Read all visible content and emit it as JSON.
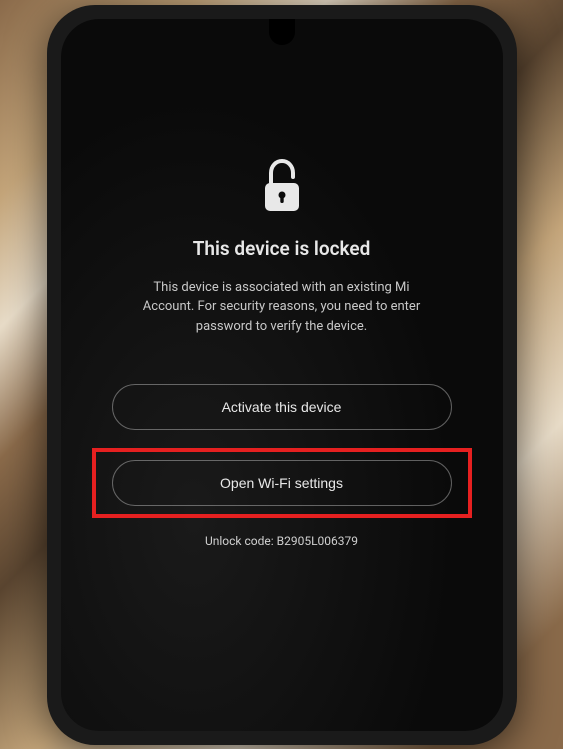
{
  "lock_screen": {
    "title": "This device is locked",
    "description": "This device is associated with an existing Mi Account. For security reasons, you need to enter password to verify the device.",
    "activate_button": "Activate this device",
    "wifi_button": "Open Wi-Fi settings",
    "unlock_code_label": "Unlock code: B2905L006379"
  }
}
